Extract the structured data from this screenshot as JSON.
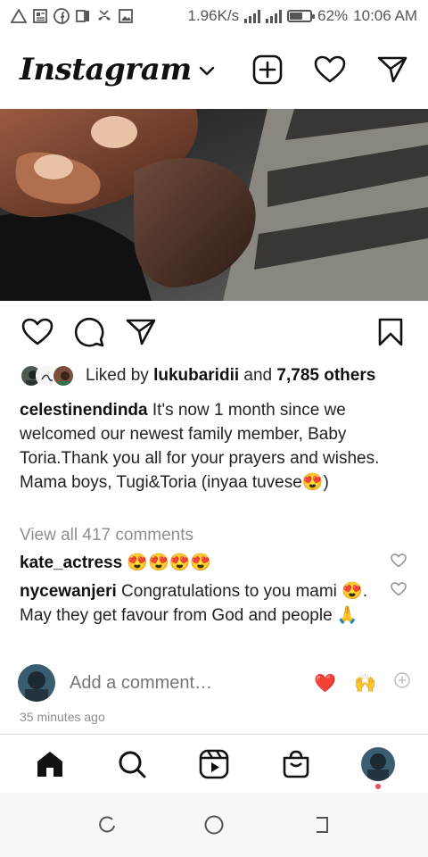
{
  "status_bar": {
    "speed": "1.96K/s",
    "battery_pct": "62%",
    "time": "10:06 AM",
    "battery_level": 0.62
  },
  "header": {
    "logo": "Instagram"
  },
  "post": {
    "likes": {
      "prefix": "Liked by ",
      "user": "lukubaridii",
      "middle": " and ",
      "count": "7,785 others"
    },
    "caption": {
      "user": "celestinendinda",
      "text": " It's now 1 month since we welcomed our newest family member, Baby Toria.Thank you all for your prayers and wishes.\nMama boys, Tugi&Toria (inyaa tuvese😍)"
    },
    "view_all": "View all 417 comments",
    "comments": [
      {
        "user": "kate_actress",
        "text": " 😍😍😍😍"
      },
      {
        "user": "nycewanjeri",
        "text": " Congratulations to you mami 😍. May they get favour from God and people 🙏"
      }
    ],
    "add_comment_placeholder": "Add a comment…",
    "quick_reactions": [
      "❤️",
      "🙌"
    ],
    "timestamp": "35 minutes ago"
  },
  "icons": {
    "header": [
      "new-post-icon",
      "heart-icon",
      "direct-message-icon"
    ],
    "post_actions": [
      "like-icon",
      "comment-icon",
      "share-icon",
      "save-icon"
    ],
    "tabs": [
      "home-icon",
      "search-icon",
      "reels-icon",
      "shop-icon",
      "profile-avatar"
    ],
    "nav": [
      "recents-icon",
      "home-button-icon",
      "back-icon"
    ]
  },
  "colors": {
    "text": "#262626",
    "muted": "#8e8e8e",
    "notification_dot": "#ed4956",
    "heart_red": "#e0245e"
  }
}
